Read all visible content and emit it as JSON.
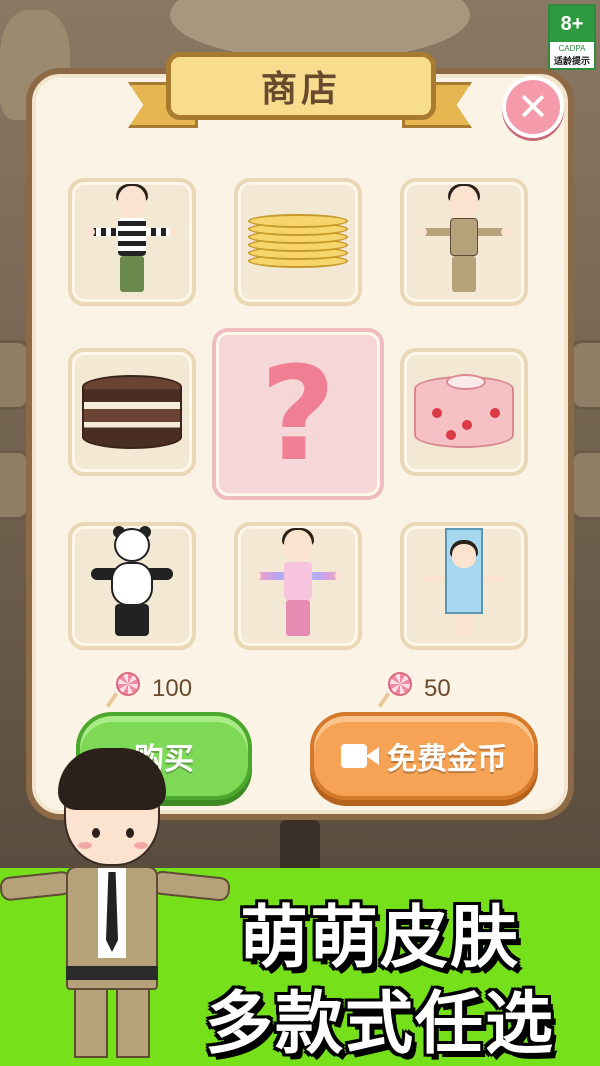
{
  "age_rating": {
    "age": "8+",
    "org": "CADPA",
    "tip": "适龄提示"
  },
  "shop": {
    "title": "商店",
    "close_icon": "close-icon",
    "items": [
      {
        "name": "skin-striped-shirt-outfit",
        "type": "skin"
      },
      {
        "name": "pancake-stack",
        "type": "cake"
      },
      {
        "name": "skin-khaki-suit",
        "type": "skin"
      },
      {
        "name": "chocolate-layer-cake",
        "type": "cake"
      },
      {
        "name": "mystery-item",
        "type": "mystery",
        "symbol": "?"
      },
      {
        "name": "cherry-roll-cake",
        "type": "cake"
      },
      {
        "name": "skin-panda-costume",
        "type": "skin"
      },
      {
        "name": "skin-rainbow-pajama",
        "type": "skin"
      },
      {
        "name": "skin-milk-carton-costume",
        "type": "skin"
      }
    ],
    "prices": {
      "buy_price": "100",
      "ad_price": "50",
      "currency_icon": "lollipop-icon"
    },
    "buttons": {
      "buy_label": "购买",
      "free_coins_label": "免费金币",
      "free_coins_icon": "video-icon"
    }
  },
  "promo": {
    "line1": "萌萌皮肤",
    "line2": "多款式任选"
  },
  "colors": {
    "panel_bg": "#fbf4e6",
    "panel_border": "#8b6a45",
    "ribbon": "#f9dd8e",
    "close_button": "#f59aaa",
    "mystery_bg": "#f6d7d8",
    "buy_button": "#7ed957",
    "free_button": "#f7a356",
    "promo_bg": "#76e01b"
  }
}
